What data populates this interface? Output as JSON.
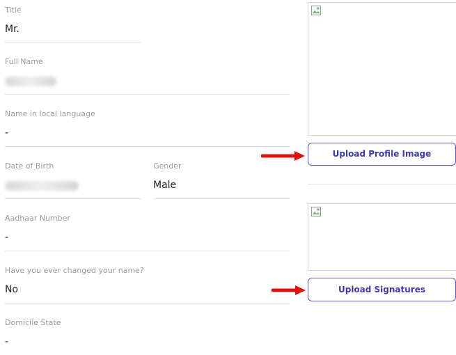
{
  "form": {
    "title": {
      "label": "Title",
      "value": "Mr."
    },
    "full_name": {
      "label": "Full Name",
      "value": ""
    },
    "local_name": {
      "label": "Name in local language",
      "value": "-"
    },
    "dob": {
      "label": "Date of Birth",
      "value": ""
    },
    "gender": {
      "label": "Gender",
      "value": "Male"
    },
    "aadhaar": {
      "label": "Aadhaar Number",
      "value": "-"
    },
    "name_changed": {
      "label": "Have you ever changed your name?",
      "value": "No"
    },
    "domicile": {
      "label": "Domicile State",
      "value": "-"
    }
  },
  "uploads": {
    "profile_button": "Upload Profile Image",
    "signature_button": "Upload Signatures"
  },
  "colors": {
    "accent": "#3d3aa8",
    "arrow": "#e01010"
  }
}
